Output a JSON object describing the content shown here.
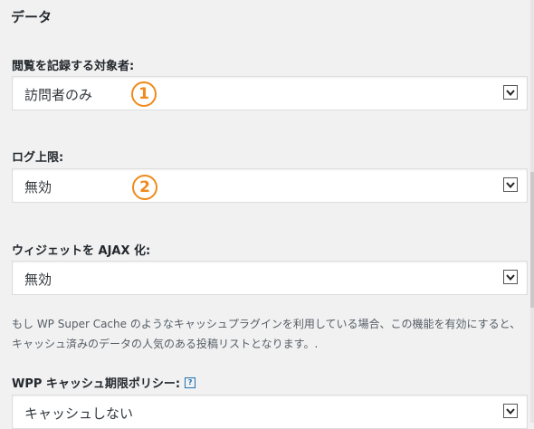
{
  "section": {
    "title": "データ"
  },
  "fields": [
    {
      "label": "閲覧を記録する対象者:",
      "value": "訪問者のみ",
      "badge": "1"
    },
    {
      "label": "ログ上限:",
      "value": "無効",
      "badge": "2"
    },
    {
      "label": "ウィジェットを AJAX 化:",
      "value": "無効"
    },
    {
      "label": "WPP キャッシュ期限ポリシー:",
      "value": "キャッシュしない",
      "help": "?"
    }
  ],
  "description": "もし WP Super Cache のようなキャッシュプラグインを利用している場合、この機能を有効にすると、キャッシュ済みのデータの人気のある投稿リストとなります。.",
  "colors": {
    "badge": "#f08a1c",
    "help": "#2271b1"
  },
  "icons": {
    "dropdown": "chevron-down-icon",
    "help": "help-icon"
  }
}
